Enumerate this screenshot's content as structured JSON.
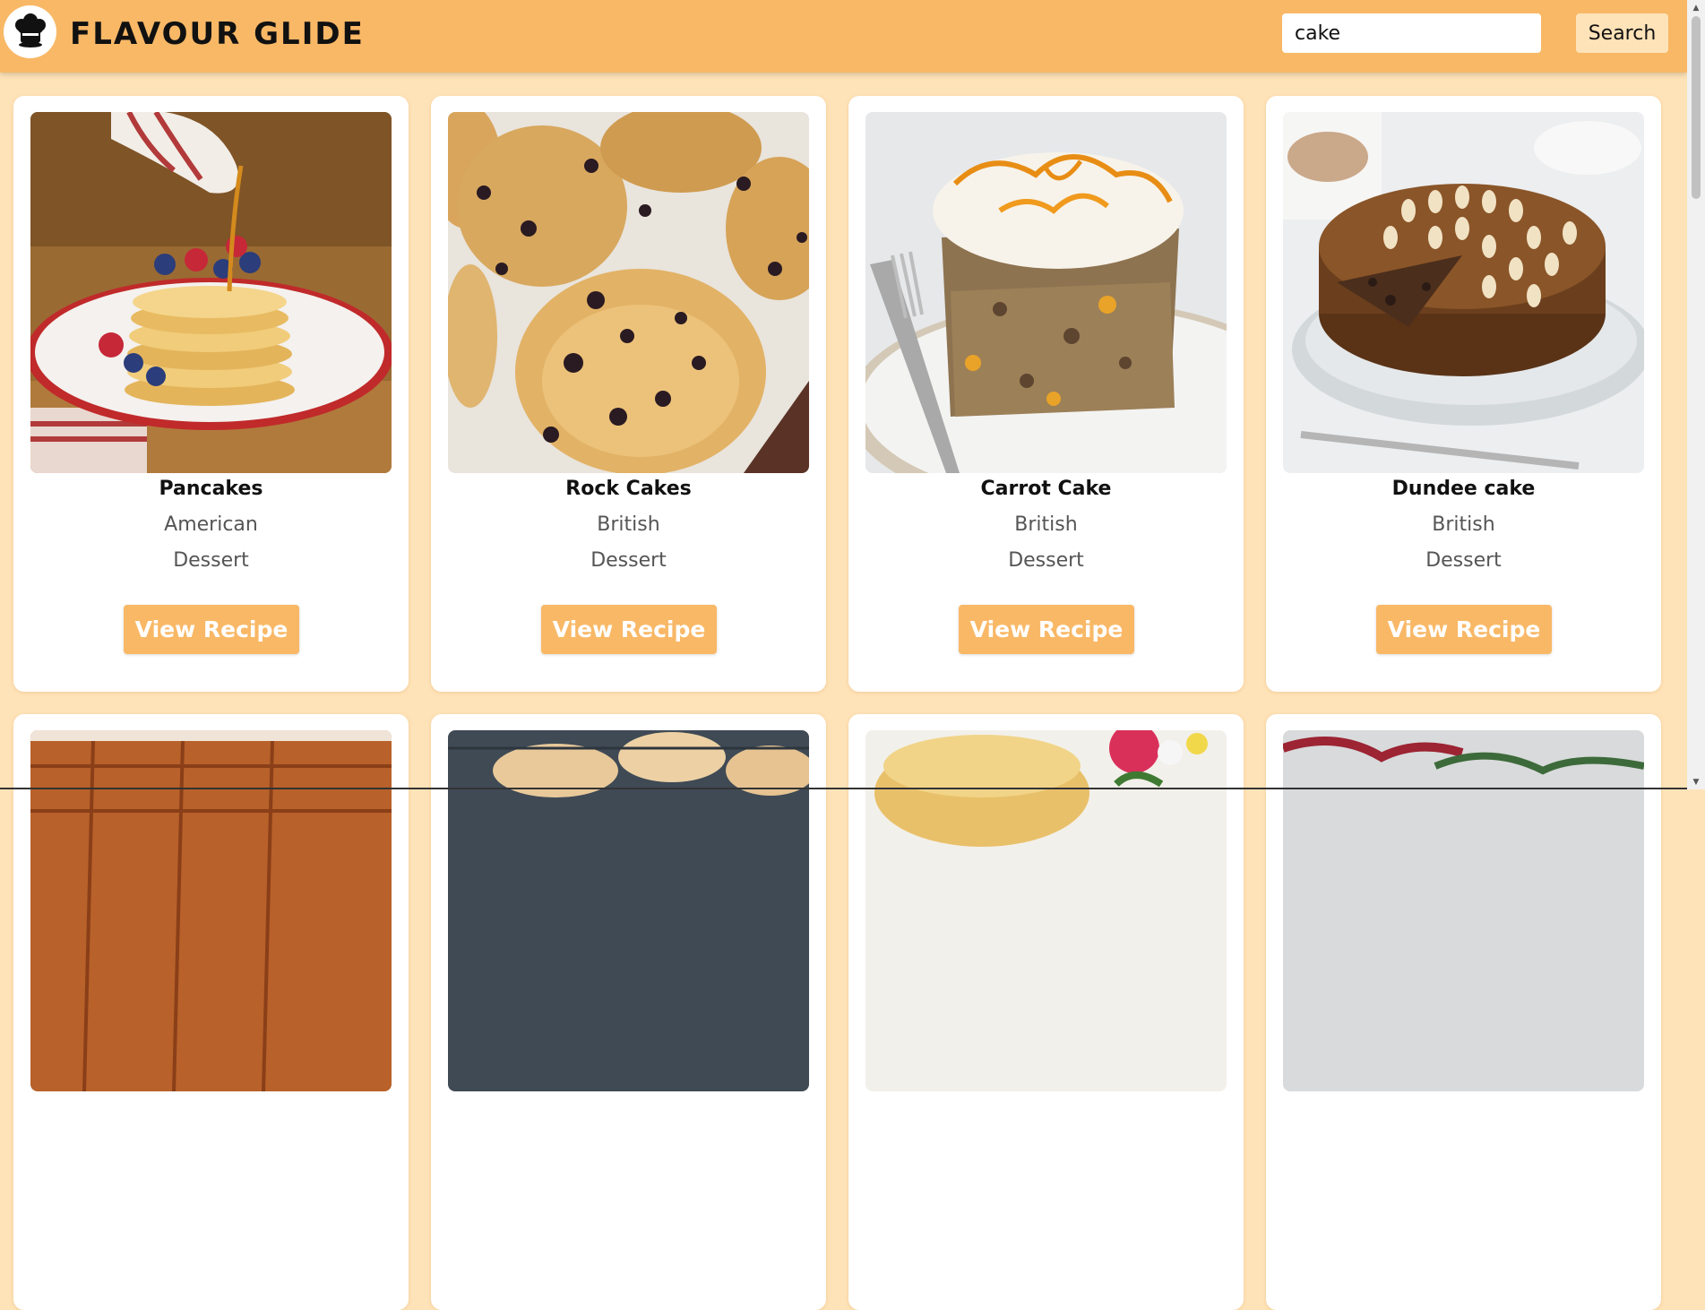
{
  "header": {
    "brand": "FLAVOUR GLIDE",
    "search_value": "cake",
    "search_button": "Search"
  },
  "colors": {
    "header_bg": "#F9B866",
    "page_bg": "#FFE3B8",
    "button_bg": "#F9B866",
    "card_bg": "#FFFFFF"
  },
  "meals": [
    {
      "name": "Pancakes",
      "area": "American",
      "category": "Dessert",
      "button": "View Recipe"
    },
    {
      "name": "Rock Cakes",
      "area": "British",
      "category": "Dessert",
      "button": "View Recipe"
    },
    {
      "name": "Carrot Cake",
      "area": "British",
      "category": "Dessert",
      "button": "View Recipe"
    },
    {
      "name": "Dundee cake",
      "area": "British",
      "category": "Dessert",
      "button": "View Recipe"
    },
    {
      "name": "",
      "area": "",
      "category": "",
      "button": ""
    },
    {
      "name": "",
      "area": "",
      "category": "",
      "button": ""
    },
    {
      "name": "",
      "area": "",
      "category": "",
      "button": ""
    },
    {
      "name": "",
      "area": "",
      "category": "",
      "button": ""
    }
  ]
}
